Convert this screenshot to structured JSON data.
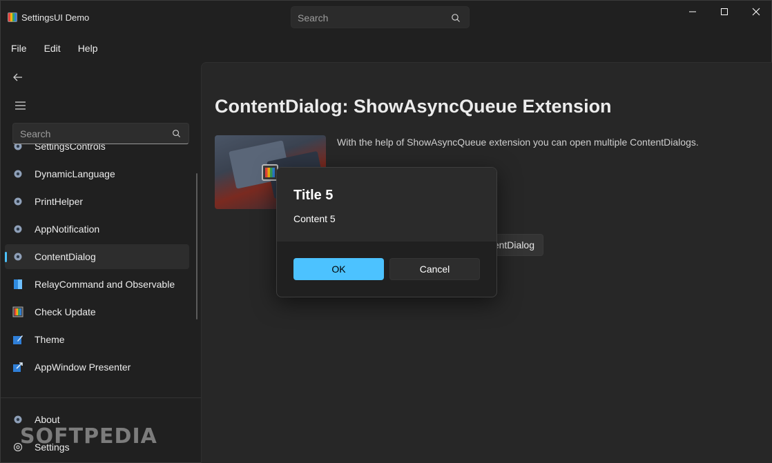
{
  "window": {
    "title": "SettingsUI Demo"
  },
  "titlebar": {
    "search_placeholder": "Search"
  },
  "menu": [
    "File",
    "Edit",
    "Help"
  ],
  "nav": {
    "search_placeholder": "Search",
    "items": [
      {
        "label": "SettingsControls",
        "icon": "gear-icon"
      },
      {
        "label": "DynamicLanguage",
        "icon": "gear-icon"
      },
      {
        "label": "PrintHelper",
        "icon": "gear-icon"
      },
      {
        "label": "AppNotification",
        "icon": "gear-icon"
      },
      {
        "label": "ContentDialog",
        "icon": "gear-icon",
        "selected": true
      },
      {
        "label": "RelayCommand and Observable",
        "icon": "document-icon"
      },
      {
        "label": "Check Update",
        "icon": "app-icon"
      },
      {
        "label": "Theme",
        "icon": "theme-icon"
      },
      {
        "label": "AppWindow Presenter",
        "icon": "window-icon"
      }
    ],
    "footer": [
      {
        "label": "About",
        "icon": "gear-icon"
      },
      {
        "label": "Settings",
        "icon": "gear-icon"
      }
    ]
  },
  "page": {
    "title": "ContentDialog: ShowAsyncQueue Extension",
    "description": "With the help of ShowAsyncQueue extension you can open multiple ContentDialogs.",
    "button_label": "ntentDialog"
  },
  "dialog": {
    "title": "Title 5",
    "content": "Content 5",
    "primary_label": "OK",
    "secondary_label": "Cancel"
  },
  "watermark": "SOFTPEDIA",
  "colors": {
    "accent": "#4cc2ff",
    "background": "#202020",
    "content": "#272727"
  }
}
